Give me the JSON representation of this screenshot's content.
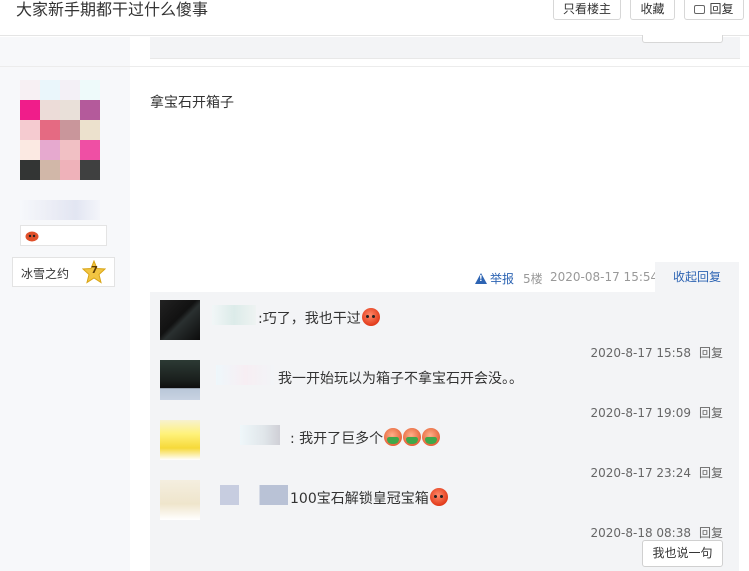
{
  "thread": {
    "title": "大家新手期都干过什么傻事"
  },
  "toolbar": {
    "only_op_label": "只看楼主",
    "favorite_label": "收藏",
    "reply_label": "回复",
    "reply_icon": "comment-icon"
  },
  "author": {
    "level_name": "冰雪之约",
    "level_number": "7",
    "badge_icon": "emoji-badge-icon"
  },
  "post": {
    "content": "拿宝石开箱子",
    "report_label": "举报",
    "floor": "5楼",
    "date": "2020-08-17 15:54",
    "collapse_label": "收起回复"
  },
  "replies": [
    {
      "text": ":巧了，我也干过",
      "emoji": [
        "tomato"
      ],
      "date": "2020-8-17 15:58",
      "reply_label": "回复"
    },
    {
      "text": "我一开始玩以为箱子不拿宝石开会没。。",
      "emoji": [],
      "date": "2020-8-17 19:09",
      "reply_label": "回复"
    },
    {
      "text": ": 我开了巨多个",
      "emoji": [
        "vomit",
        "vomit",
        "vomit"
      ],
      "date": "2020-8-17 23:24",
      "reply_label": "回复"
    },
    {
      "text": "100宝石解锁皇冠宝箱",
      "emoji": [
        "tomato"
      ],
      "date": "2020-8-18 08:38",
      "reply_label": "回复"
    }
  ],
  "say_button_label": "我也说一句",
  "colors": {
    "link": "#2d64b3",
    "panel": "#f3f4f6"
  }
}
